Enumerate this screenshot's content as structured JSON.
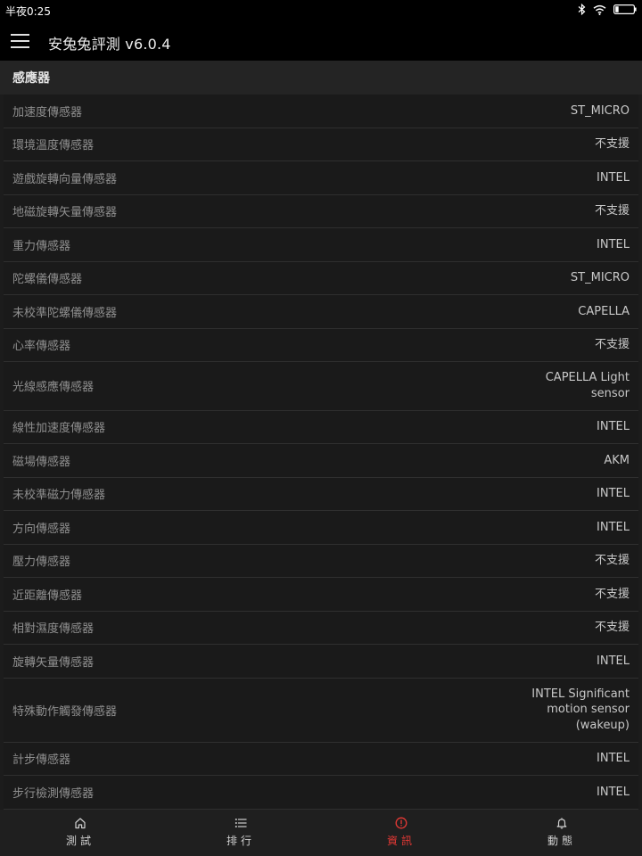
{
  "status_bar": {
    "time": "半夜0:25"
  },
  "app_bar": {
    "title": "安兔兔評測 v6.0.4",
    "menu_icon": "hamburger-menu-icon"
  },
  "section": {
    "title": "感應器"
  },
  "rows": [
    {
      "label": "加速度傳感器",
      "value": "ST_MICRO"
    },
    {
      "label": "環境溫度傳感器",
      "value": "不支援"
    },
    {
      "label": "遊戲旋轉向量傳感器",
      "value": "INTEL"
    },
    {
      "label": "地磁旋轉矢量傳感器",
      "value": "不支援"
    },
    {
      "label": "重力傳感器",
      "value": "INTEL"
    },
    {
      "label": "陀螺儀傳感器",
      "value": "ST_MICRO"
    },
    {
      "label": "未校準陀螺儀傳感器",
      "value": "CAPELLA"
    },
    {
      "label": "心率傳感器",
      "value": "不支援"
    },
    {
      "label": "光線感應傳感器",
      "value": "CAPELLA Light\nsensor"
    },
    {
      "label": "線性加速度傳感器",
      "value": "INTEL"
    },
    {
      "label": "磁場傳感器",
      "value": "AKM"
    },
    {
      "label": "未校準磁力傳感器",
      "value": "INTEL"
    },
    {
      "label": "方向傳感器",
      "value": "INTEL"
    },
    {
      "label": "壓力傳感器",
      "value": "不支援"
    },
    {
      "label": "近距離傳感器",
      "value": "不支援"
    },
    {
      "label": "相對濕度傳感器",
      "value": "不支援"
    },
    {
      "label": "旋轉矢量傳感器",
      "value": "INTEL"
    },
    {
      "label": "特殊動作觸發傳感器",
      "value": "INTEL Significant\nmotion sensor\n(wakeup)"
    },
    {
      "label": "計步傳感器",
      "value": "INTEL"
    },
    {
      "label": "步行檢測傳感器",
      "value": "INTEL"
    }
  ],
  "bottom_nav": [
    {
      "label": "測試",
      "icon": "home-icon",
      "active": false
    },
    {
      "label": "排行",
      "icon": "list-icon",
      "active": false
    },
    {
      "label": "資訊",
      "icon": "info-alert-icon",
      "active": true
    },
    {
      "label": "動態",
      "icon": "bell-icon",
      "active": false
    }
  ],
  "colors": {
    "accent": "#e53935",
    "background": "#1c1c1c",
    "bar": "#000000"
  }
}
